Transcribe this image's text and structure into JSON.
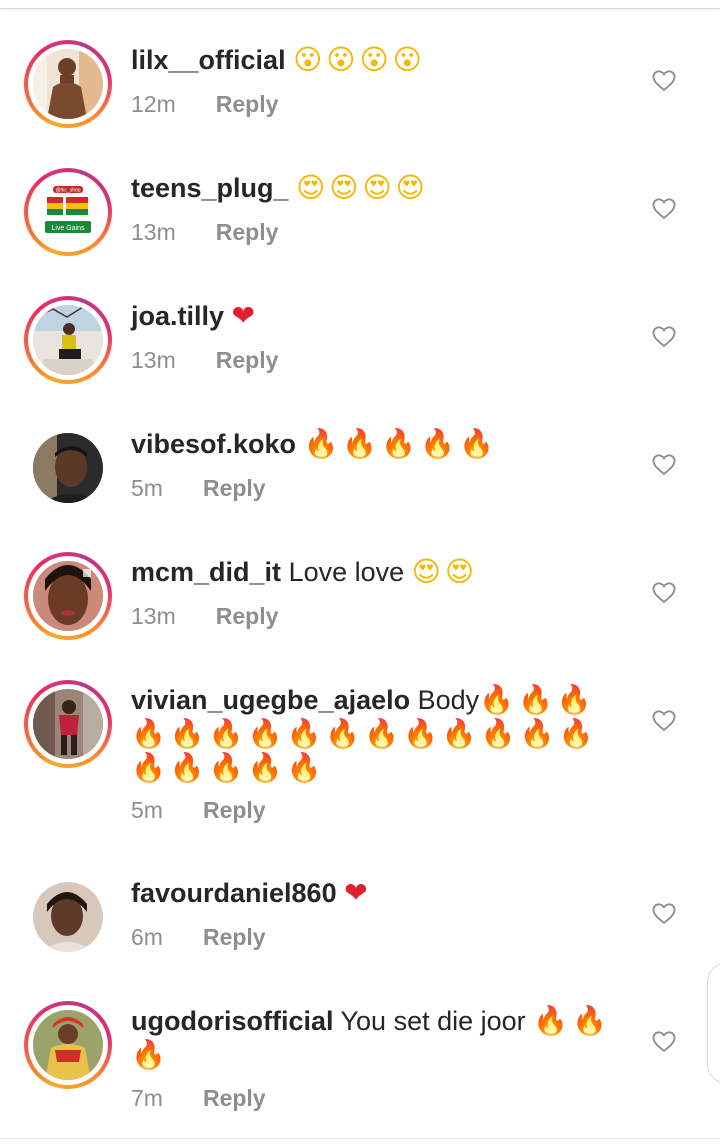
{
  "icons": {
    "like": "heart-outline-icon"
  },
  "colors": {
    "username": "#262626",
    "meta": "#8e8e8e",
    "story_ring_start": "#f9a825",
    "story_ring_end": "#c13584"
  },
  "comments": [
    {
      "username": "lilx__official",
      "text": "",
      "emoji": "😮😮😮😮",
      "time": "12m",
      "reply": "Reply"
    },
    {
      "username": "teens_plug_",
      "text": "",
      "emoji": "😍😍😍😍",
      "time": "13m",
      "reply": "Reply",
      "avatar_text": "Live Gains",
      "avatar_handle": "@hic_shop"
    },
    {
      "username": "joa.tilly",
      "text": "",
      "emoji": "❤",
      "time": "13m",
      "reply": "Reply"
    },
    {
      "username": "vibesof.koko",
      "text": "",
      "emoji": "🔥🔥🔥🔥🔥",
      "time": "5m",
      "reply": "Reply"
    },
    {
      "username": "mcm_did_it",
      "text": "Love love",
      "emoji": "😍😍",
      "time": "13m",
      "reply": "Reply"
    },
    {
      "username": "vivian_ugegbe_ajaelo",
      "text": "Body",
      "emoji": "🔥🔥🔥🔥🔥🔥🔥🔥🔥🔥🔥🔥🔥🔥🔥🔥🔥🔥🔥🔥",
      "time": "5m",
      "reply": "Reply"
    },
    {
      "username": "favourdaniel860",
      "text": "",
      "emoji": "❤",
      "time": "6m",
      "reply": "Reply"
    },
    {
      "username": "ugodorisofficial",
      "text": "You set die joor",
      "emoji": "🔥🔥🔥",
      "time": "7m",
      "reply": "Reply"
    }
  ]
}
